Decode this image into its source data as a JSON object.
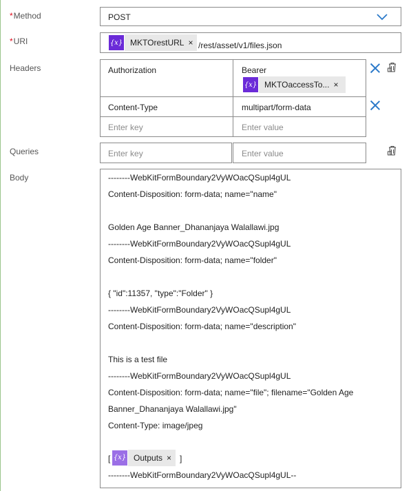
{
  "method": {
    "label": "Method",
    "value": "POST",
    "icons": {
      "dropdown": "chevron-down-icon"
    }
  },
  "uri": {
    "label": "URI",
    "token": {
      "label": "MKTOrestURL",
      "icon": "expression-icon"
    },
    "path": "/rest/asset/v1/files.json"
  },
  "headers": {
    "label": "Headers",
    "rows": [
      {
        "key": "Authorization",
        "value_text": "Bearer",
        "value_token": "MKTOaccessTo..."
      },
      {
        "key": "Content-Type",
        "value_text": "multipart/form-data"
      }
    ],
    "key_placeholder": "Enter key",
    "value_placeholder": "Enter value"
  },
  "queries": {
    "label": "Queries",
    "key_placeholder": "Enter key",
    "value_placeholder": "Enter value"
  },
  "body": {
    "label": "Body",
    "lines": [
      "--------WebKitFormBoundary2VyWOacQSupl4gUL",
      "Content-Disposition: form-data; name=\"name\"",
      "",
      "Golden Age Banner_Dhananjaya Walallawi.jpg",
      "--------WebKitFormBoundary2VyWOacQSupl4gUL",
      "Content-Disposition: form-data; name=\"folder\"",
      "",
      "{ \"id\":11357, \"type\":\"Folder\" }",
      "--------WebKitFormBoundary2VyWOacQSupl4gUL",
      "Content-Disposition: form-data; name=\"description\"",
      "",
      "This is a test file",
      "--------WebKitFormBoundary2VyWOacQSupl4gUL",
      "Content-Disposition: form-data; name=\"file\"; filename=\"Golden Age",
      "Banner_Dhananjaya Walallawi.jpg\"",
      "Content-Type: image/jpeg",
      ""
    ],
    "token_open": "[",
    "token_label": "Outputs",
    "token_close": "]",
    "last_line": "--------WebKitFormBoundary2VyWOacQSupl4gUL--"
  },
  "colors": {
    "accent": "#2b79c9",
    "token_icon": "#6b2bd8",
    "required": "#e00b1c"
  }
}
